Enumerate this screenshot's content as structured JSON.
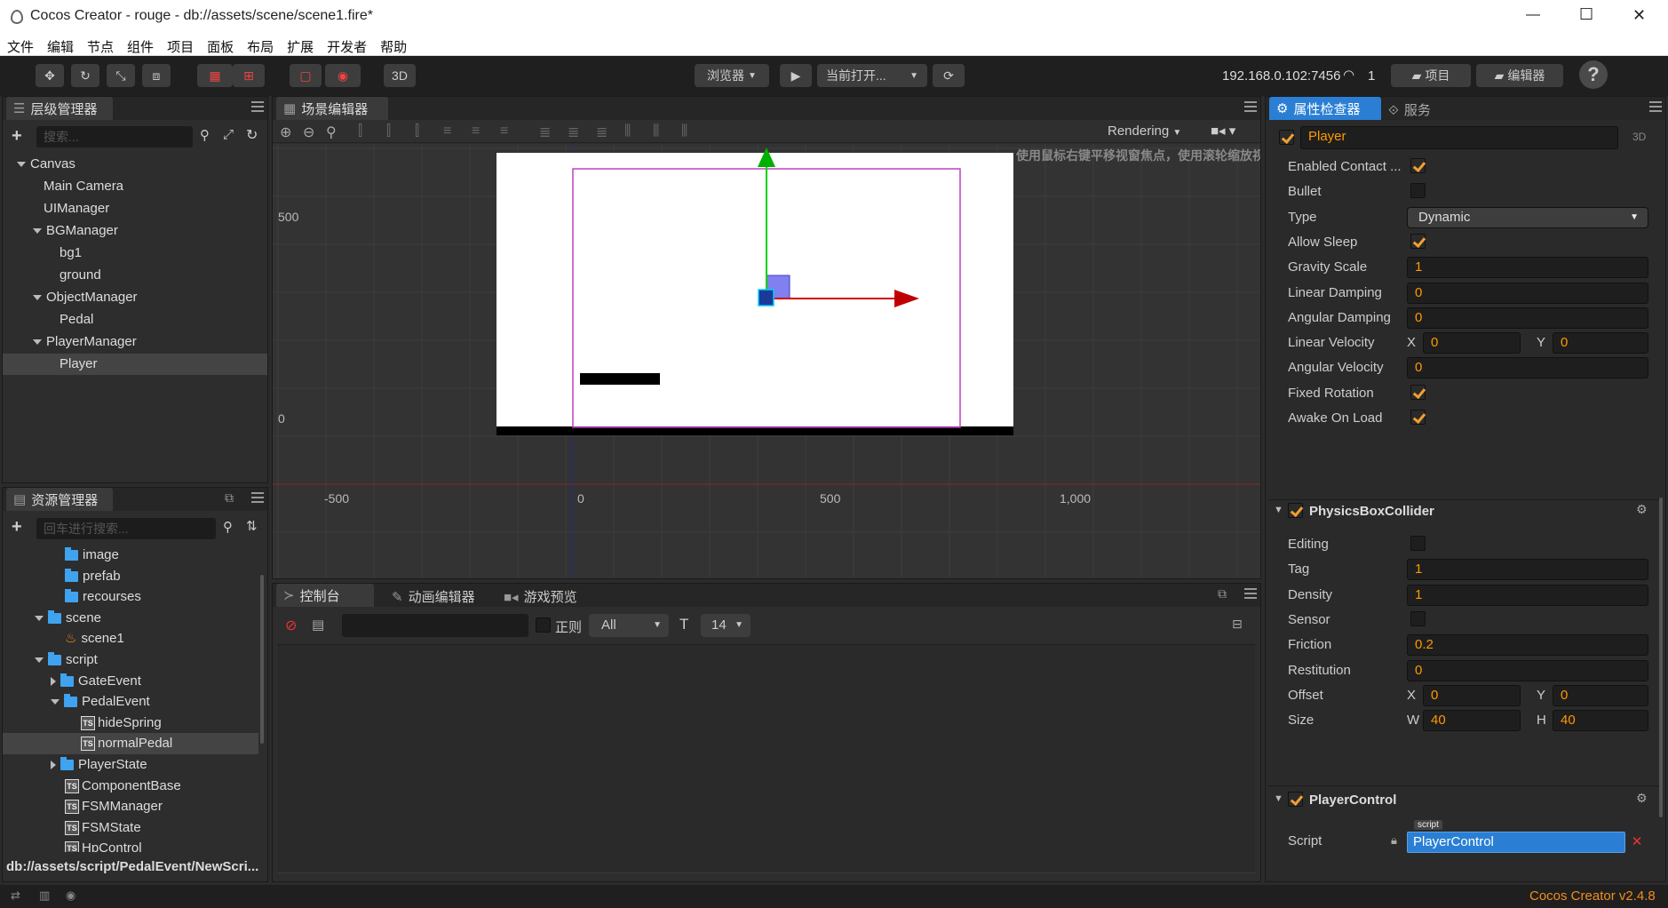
{
  "window": {
    "title": "Cocos Creator - rouge - db://assets/scene/scene1.fire*",
    "minimize": "—",
    "maximize": "☐",
    "close": "✕"
  },
  "menu": [
    "文件",
    "编辑",
    "节点",
    "组件",
    "项目",
    "面板",
    "布局",
    "扩展",
    "开发者",
    "帮助"
  ],
  "toolbar": {
    "mode_3d": "3D",
    "browser": "浏览器",
    "play": "▶",
    "current": "当前打开...",
    "refresh": "⟳",
    "ip": "192.168.0.102:7456",
    "conn_count": "1",
    "project_btn": "项目",
    "editor_btn": "编辑器",
    "help": "?"
  },
  "hierarchy": {
    "title": "层级管理器",
    "search_placeholder": "搜索...",
    "nodes": [
      {
        "label": "Canvas",
        "depth": 0,
        "arrow": "down"
      },
      {
        "label": "Main Camera",
        "depth": 1,
        "arrow": "none"
      },
      {
        "label": "UIManager",
        "depth": 1,
        "arrow": "none"
      },
      {
        "label": "BGManager",
        "depth": 1,
        "arrow": "down"
      },
      {
        "label": "bg1",
        "depth": 2,
        "arrow": "none"
      },
      {
        "label": "ground",
        "depth": 2,
        "arrow": "none"
      },
      {
        "label": "ObjectManager",
        "depth": 1,
        "arrow": "down"
      },
      {
        "label": "Pedal",
        "depth": 2,
        "arrow": "none"
      },
      {
        "label": "PlayerManager",
        "depth": 1,
        "arrow": "down"
      },
      {
        "label": "Player",
        "depth": 2,
        "arrow": "none",
        "selected": true
      }
    ]
  },
  "assets": {
    "title": "资源管理器",
    "search_placeholder": "回车进行搜索...",
    "items": [
      {
        "label": "image",
        "type": "folder",
        "depth": 1,
        "arrow": "none"
      },
      {
        "label": "prefab",
        "type": "folder",
        "depth": 1,
        "arrow": "none"
      },
      {
        "label": "recourses",
        "type": "folder",
        "depth": 1,
        "arrow": "none"
      },
      {
        "label": "scene",
        "type": "folder",
        "depth": 0,
        "arrow": "down"
      },
      {
        "label": "scene1",
        "type": "fire",
        "depth": 1,
        "arrow": "none"
      },
      {
        "label": "script",
        "type": "folder",
        "depth": 0,
        "arrow": "down"
      },
      {
        "label": "GateEvent",
        "type": "folder",
        "depth": 1,
        "arrow": "right"
      },
      {
        "label": "PedalEvent",
        "type": "folder",
        "depth": 1,
        "arrow": "down"
      },
      {
        "label": "hideSpring",
        "type": "ts",
        "depth": 2,
        "arrow": "none"
      },
      {
        "label": "normalPedal",
        "type": "ts",
        "depth": 2,
        "arrow": "none",
        "selected": true
      },
      {
        "label": "PlayerState",
        "type": "folder",
        "depth": 1,
        "arrow": "right"
      },
      {
        "label": "ComponentBase",
        "type": "ts",
        "depth": 1,
        "arrow": "none"
      },
      {
        "label": "FSMManager",
        "type": "ts",
        "depth": 1,
        "arrow": "none"
      },
      {
        "label": "FSMState",
        "type": "ts",
        "depth": 1,
        "arrow": "none"
      },
      {
        "label": "HpControl",
        "type": "ts",
        "depth": 1,
        "arrow": "none"
      }
    ],
    "path": "db://assets/script/PedalEvent/NewScri..."
  },
  "scene": {
    "title": "场景编辑器",
    "rendering": "Rendering",
    "hint": "使用鼠标右键平移视窗焦点，使用滚轮缩放视图",
    "y_ticks": [
      "500",
      "0"
    ],
    "x_ticks": [
      "-500",
      "0",
      "500",
      "1,000"
    ]
  },
  "console": {
    "tabs": [
      "控制台",
      "动画编辑器",
      "游戏预览"
    ],
    "regex": "正则",
    "level": "All",
    "font_size": "14"
  },
  "inspector": {
    "tabs": [
      "属性检查器",
      "服务"
    ],
    "node_name": "Player",
    "mode": "3D",
    "rigidbody": [
      {
        "label": "Enabled Contact ...",
        "kind": "check",
        "value": true
      },
      {
        "label": "Bullet",
        "kind": "check",
        "value": false
      },
      {
        "label": "Type",
        "kind": "select",
        "value": "Dynamic"
      },
      {
        "label": "Allow Sleep",
        "kind": "check",
        "value": true
      },
      {
        "label": "Gravity Scale",
        "kind": "num",
        "value": "1"
      },
      {
        "label": "Linear Damping",
        "kind": "num",
        "value": "0"
      },
      {
        "label": "Angular Damping",
        "kind": "num",
        "value": "0"
      },
      {
        "label": "Linear Velocity",
        "kind": "xy",
        "x": "0",
        "y": "0",
        "xl": "X",
        "yl": "Y"
      },
      {
        "label": "Angular Velocity",
        "kind": "num",
        "value": "0"
      },
      {
        "label": "Fixed Rotation",
        "kind": "check",
        "value": true
      },
      {
        "label": "Awake On Load",
        "kind": "check",
        "value": true
      }
    ],
    "collider_title": "PhysicsBoxCollider",
    "collider": [
      {
        "label": "Editing",
        "kind": "check",
        "value": false
      },
      {
        "label": "Tag",
        "kind": "num",
        "value": "1"
      },
      {
        "label": "Density",
        "kind": "num",
        "value": "1"
      },
      {
        "label": "Sensor",
        "kind": "check",
        "value": false
      },
      {
        "label": "Friction",
        "kind": "num",
        "value": "0.2"
      },
      {
        "label": "Restitution",
        "kind": "num",
        "value": "0"
      },
      {
        "label": "Offset",
        "kind": "xy",
        "x": "0",
        "y": "0",
        "xl": "X",
        "yl": "Y"
      },
      {
        "label": "Size",
        "kind": "xy",
        "x": "40",
        "y": "40",
        "xl": "W",
        "yl": "H"
      }
    ],
    "control_title": "PlayerControl",
    "script_label": "Script",
    "script_tag": "script",
    "script_value": "PlayerControl"
  },
  "status": {
    "version": "Cocos Creator v2.4.8"
  },
  "colors": {
    "accent": "#2a7fd4",
    "orange": "#f28c1c",
    "gizmo_x": "#cc0000",
    "gizmo_y": "#00b000",
    "canvas_border": "#c040c0"
  }
}
